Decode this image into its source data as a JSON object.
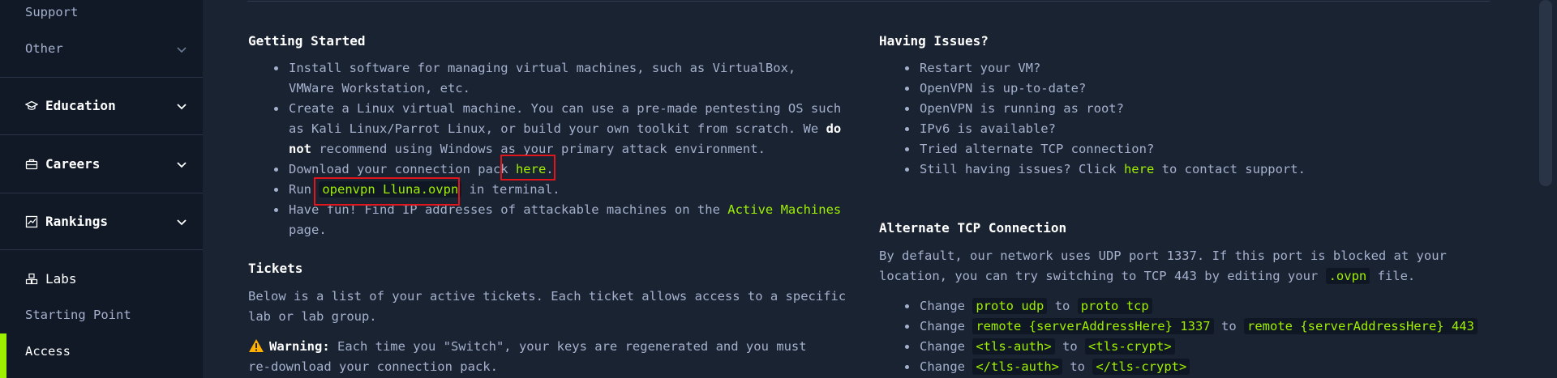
{
  "sidebar": {
    "support_label": "Support",
    "other_label": "Other",
    "education_label": "Education",
    "careers_label": "Careers",
    "rankings_label": "Rankings",
    "labs_label": "Labs",
    "starting_point_label": "Starting Point",
    "access_label": "Access"
  },
  "getting_started": {
    "title": "Getting Started",
    "item1": "Install software for managing virtual machines, such as VirtualBox, VMWare Workstation, etc.",
    "item2_a": "Create a Linux virtual machine. You can use a pre-made pentesting OS such as Kali Linux/Parrot Linux, or build your own toolkit from scratch. We ",
    "item2_bold": "do not",
    "item2_b": " recommend using Windows as your primary attack environment.",
    "item3_a": "Download your connection pack ",
    "item3_link": "here",
    "item3_b": ".",
    "item4_a": "Run ",
    "item4_code": "openvpn Lluna.ovpn",
    "item4_b": " in terminal.",
    "item5_a": "Have fun! Find IP addresses of attackable machines on the ",
    "item5_link": "Active Machines",
    "item5_b": " page."
  },
  "tickets": {
    "title": "Tickets",
    "desc": "Below is a list of your active tickets. Each ticket allows access to a specific lab or lab group.",
    "warning_label": "Warning:",
    "warning_text": " Each time you \"Switch\", your keys are regenerated and you must re-download your connection pack."
  },
  "having_issues": {
    "title": "Having Issues?",
    "items": [
      "Restart your VM?",
      "OpenVPN is up-to-date?",
      "OpenVPN is running as root?",
      "IPv6 is available?",
      "Tried alternate TCP connection?"
    ],
    "last_a": "Still having issues? Click ",
    "last_link": "here",
    "last_b": " to contact support."
  },
  "tcp": {
    "title": "Alternate TCP Connection",
    "desc_a": "By default, our network uses UDP port 1337. If this port is blocked at your location, you can try switching to TCP 443 by editing your ",
    "desc_code": ".ovpn",
    "desc_b": " file.",
    "change_label": "Change",
    "to_label": "to",
    "rows": [
      {
        "from": "proto udp",
        "to": "proto tcp"
      },
      {
        "from": "remote {serverAddressHere} 1337",
        "to": "remote {serverAddressHere} 443"
      },
      {
        "from": "<tls-auth>",
        "to": "<tls-crypt>"
      },
      {
        "from": "</tls-auth>",
        "to": "</tls-crypt>"
      }
    ]
  },
  "colors": {
    "accent": "#9fef00",
    "bg": "#1a2332",
    "sidebar_bg": "#111927",
    "highlight_box": "#e1161d"
  }
}
